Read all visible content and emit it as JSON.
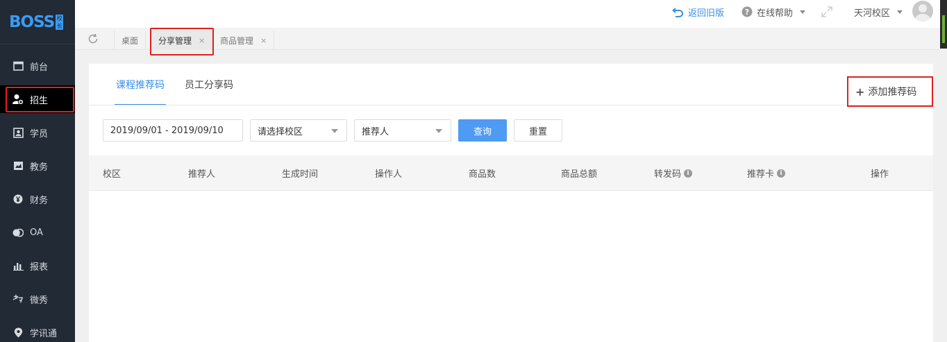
{
  "app": {
    "logo_text": "BOSS",
    "logo_badge": "校长"
  },
  "sidebar": {
    "items": [
      {
        "label": "前台",
        "icon": "calendar-icon"
      },
      {
        "label": "招生",
        "icon": "user-add-icon"
      },
      {
        "label": "学员",
        "icon": "id-card-icon"
      },
      {
        "label": "教务",
        "icon": "book-icon"
      },
      {
        "label": "财务",
        "icon": "yen-icon"
      },
      {
        "label": "OA",
        "icon": "oa-icon"
      },
      {
        "label": "报表",
        "icon": "bar-chart-icon"
      },
      {
        "label": "微秀",
        "icon": "show-icon"
      },
      {
        "label": "学讯通",
        "icon": "location-icon"
      }
    ],
    "active_index": 1
  },
  "header": {
    "back_label": "返回旧版",
    "help_label": "在线帮助",
    "campus_label": "天河校区"
  },
  "tabs": [
    {
      "label": "桌面"
    },
    {
      "label": "分享管理",
      "close": "×"
    },
    {
      "label": "商品管理",
      "close": "×"
    }
  ],
  "main": {
    "subtabs": [
      "课程推荐码",
      "员工分享码"
    ],
    "add_label": "添加推荐码",
    "add_icon": "+",
    "filters": {
      "date_range": "2019/09/01 - 2019/09/10",
      "campus_placeholder": "请选择校区",
      "referrer_placeholder": "推荐人",
      "search_label": "查询",
      "reset_label": "重置"
    },
    "table": {
      "columns": [
        "校区",
        "推荐人",
        "生成时间",
        "操作人",
        "商品数",
        "商品总额",
        "转发码",
        "推荐卡",
        "操作"
      ],
      "info_icon": "i"
    }
  },
  "colors": {
    "accent": "#3a8ee6",
    "sidebar_bg": "#222a35",
    "highlight": "#e02020"
  }
}
